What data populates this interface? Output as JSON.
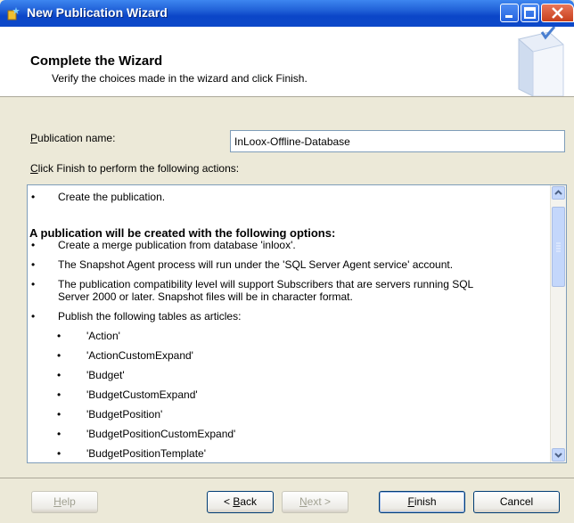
{
  "window": {
    "title": "New Publication Wizard"
  },
  "header": {
    "title": "Complete the Wizard",
    "subtitle": "Verify the choices made in the wizard and click Finish."
  },
  "form": {
    "pub_label_prefix": "P",
    "pub_label_rest": "ublication name:",
    "pub_value": "InLoox-Offline-Database",
    "actions_prefix": "C",
    "actions_rest": "lick Finish to perform the following actions:"
  },
  "list": {
    "create": "Create the publication.",
    "options_heading": "A publication will be created with the following options:",
    "opt1": "Create a merge publication from database 'inloox'.",
    "opt2": "The Snapshot Agent process will run under the 'SQL Server Agent service' account.",
    "opt3a": "The publication compatibility level will support Subscribers that are servers running SQL",
    "opt3b": "Server 2000 or later. Snapshot files will be in character format.",
    "opt4": "Publish the following tables as articles:",
    "tables": [
      "'Action'",
      "'ActionCustomExpand'",
      "'Budget'",
      "'BudgetCustomExpand'",
      "'BudgetPosition'",
      "'BudgetPositionCustomExpand'",
      "'BudgetPositionTemplate'"
    ],
    "bullet": "•"
  },
  "buttons": {
    "help_u": "H",
    "help_rest": "elp",
    "back_pre": "< ",
    "back_u": "B",
    "back_rest": "ack",
    "next_u": "N",
    "next_rest": "ext >",
    "finish_u": "F",
    "finish_rest": "inish",
    "cancel": "Cancel"
  },
  "colors": {
    "titlebar": "#0b46c8",
    "dialog_bg": "#ece9d8"
  }
}
